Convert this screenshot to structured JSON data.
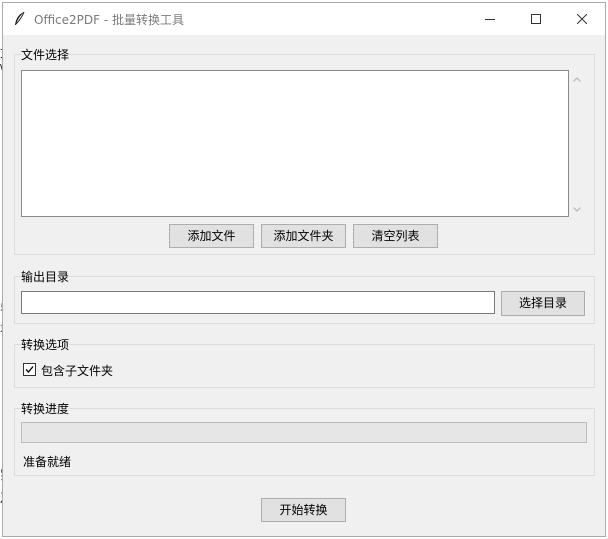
{
  "window": {
    "title": "Office2PDF - 批量转换工具"
  },
  "file_selection": {
    "label": "文件选择",
    "files": [],
    "buttons": {
      "add_files": "添加文件",
      "add_folder": "添加文件夹",
      "clear_list": "清空列表"
    }
  },
  "output": {
    "label": "输出目录",
    "directory_value": "",
    "browse_button": "选择目录"
  },
  "options": {
    "label": "转换选项",
    "include_subfolders_label": "包含子文件夹",
    "include_subfolders_checked": true
  },
  "progress": {
    "label": "转换进度",
    "value": 0,
    "status": "准备就绪"
  },
  "actions": {
    "start_button": "开始转换"
  },
  "icons": {
    "app": "feather-icon",
    "minimize": "minimize-icon",
    "maximize": "maximize-icon",
    "close": "close-icon"
  },
  "colors": {
    "window_bg": "#f0f0f0",
    "button_bg": "#e1e1e1",
    "progress_fill": "#06b025"
  }
}
